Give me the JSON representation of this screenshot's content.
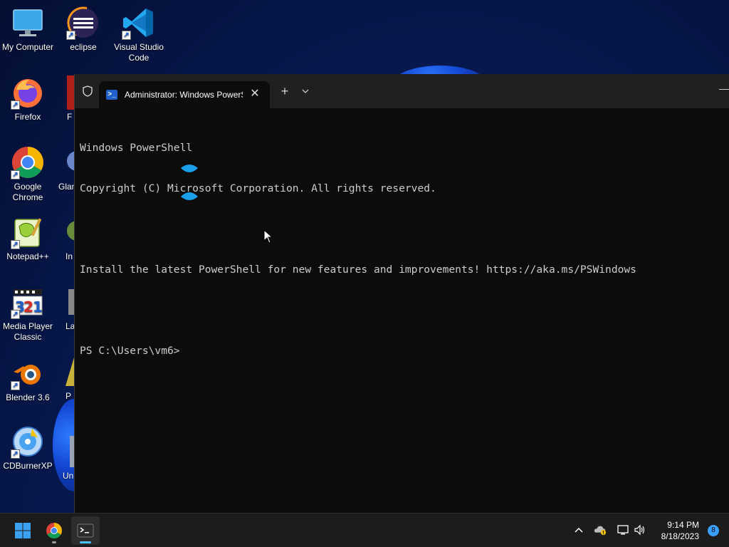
{
  "desktop": {
    "icons": [
      {
        "label": "My Computer"
      },
      {
        "label": "eclipse"
      },
      {
        "label": "Visual Studio Code"
      },
      {
        "label": "Firefox"
      },
      {
        "label": "Google Chrome"
      },
      {
        "label": "Notepad++"
      },
      {
        "label": "Media Player Classic"
      },
      {
        "label": "Blender 3.6"
      },
      {
        "label": "CDBurnerXP"
      }
    ],
    "partial_icons": [
      {
        "label": "F"
      },
      {
        "label": "Glan"
      },
      {
        "label": "In"
      },
      {
        "label": "La"
      },
      {
        "label": "P"
      },
      {
        "label": "Un"
      }
    ]
  },
  "terminal": {
    "tab_title": "Administrator: Windows PowerShell",
    "lines": [
      "Windows PowerShell",
      "Copyright (C) Microsoft Corporation. All rights reserved.",
      "",
      "Install the latest PowerShell for new features and improvements! https://aka.ms/PSWindows",
      "",
      "PS C:\\Users\\vm6>"
    ]
  },
  "taskbar": {
    "time": "9:14 PM",
    "date": "8/18/2023",
    "notification_count": "8"
  },
  "colors": {
    "terminal_bg": "#0c0c0c",
    "titlebar_bg": "#202020",
    "taskbar_bg": "#1c1c1c",
    "accent": "#1aa0e8"
  }
}
